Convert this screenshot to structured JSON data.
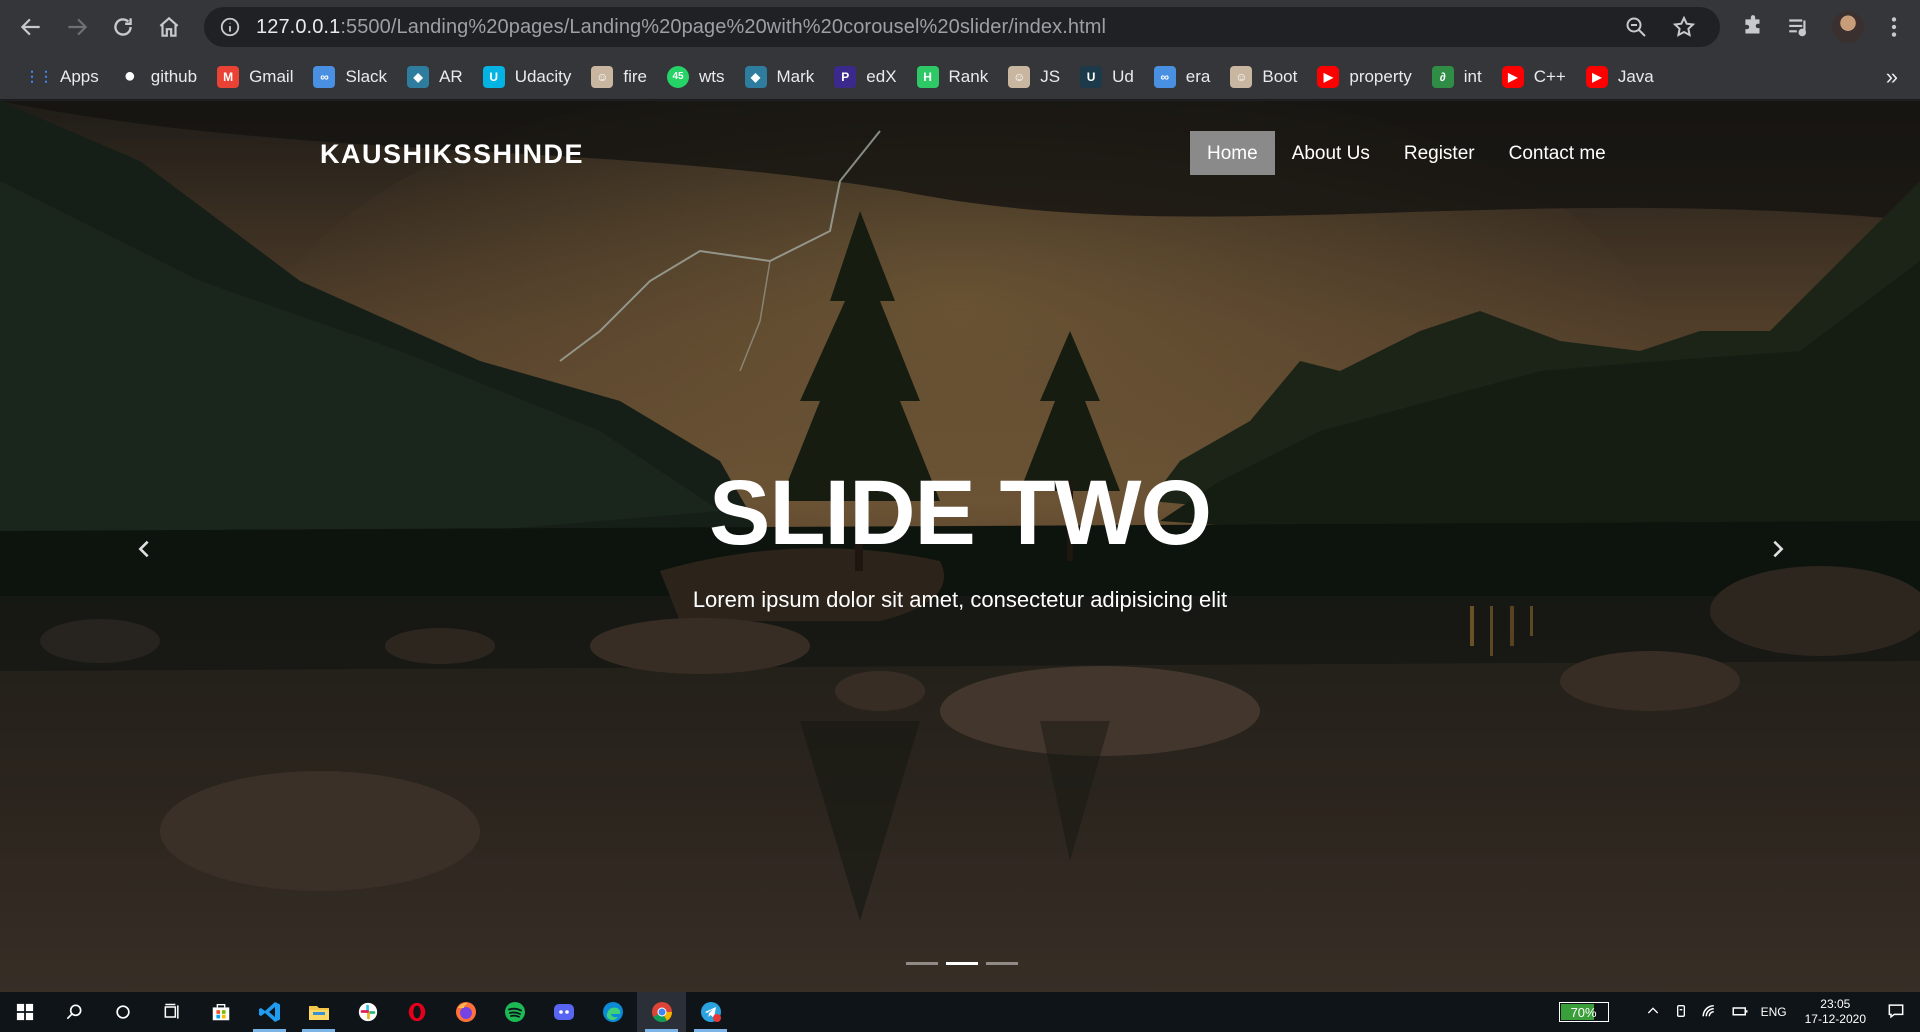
{
  "browser": {
    "url_host": "127.0.0.1",
    "url_path": ":5500/Landing%20pages/Landing%20page%20with%20corousel%20slider/index.html",
    "toolbar_icons": [
      "back-icon",
      "forward-icon",
      "reload-icon",
      "home-icon",
      "info-icon",
      "zoom-icon",
      "star-icon",
      "extensions-icon",
      "media-icon",
      "profile-avatar",
      "menu-icon"
    ]
  },
  "bookmarks": [
    {
      "label": "Apps",
      "icon": "apps-grid-icon",
      "color": "#4285f4"
    },
    {
      "label": "github",
      "icon": "github-icon",
      "color": "#ffffff"
    },
    {
      "label": "Gmail",
      "icon": "gmail-icon",
      "color": "#ea4335"
    },
    {
      "label": "Slack",
      "icon": "infinity-icon",
      "color": "#4a90e2"
    },
    {
      "label": "AR",
      "icon": "globe-icon",
      "color": "#2e7d9f"
    },
    {
      "label": "Udacity",
      "icon": "udacity-icon",
      "color": "#02b3e4"
    },
    {
      "label": "fire",
      "icon": "face-icon",
      "color": "#c9b6a0"
    },
    {
      "label": "wts",
      "icon": "whatsapp-icon",
      "color": "#25d366",
      "badge": "45"
    },
    {
      "label": "Mark",
      "icon": "globe-icon",
      "color": "#2e7d9f"
    },
    {
      "label": "edX",
      "icon": "p-icon",
      "color": "#3b2a8c"
    },
    {
      "label": "Rank",
      "icon": "hackerrank-icon",
      "color": "#2ec866"
    },
    {
      "label": "JS",
      "icon": "face-icon",
      "color": "#c9b6a0"
    },
    {
      "label": "Ud",
      "icon": "udemy-icon",
      "color": "#1c3a4a"
    },
    {
      "label": "era",
      "icon": "infinity-icon",
      "color": "#4a90e2"
    },
    {
      "label": "Boot",
      "icon": "face-icon",
      "color": "#c9b6a0"
    },
    {
      "label": "property",
      "icon": "youtube-icon",
      "color": "#ff0000"
    },
    {
      "label": "int",
      "icon": "gfg-icon",
      "color": "#2f8d46"
    },
    {
      "label": "C++",
      "icon": "youtube-icon",
      "color": "#ff0000"
    },
    {
      "label": "Java",
      "icon": "youtube-icon",
      "color": "#ff0000"
    }
  ],
  "bookmarks_overflow": "»",
  "page": {
    "brand": "KAUSHIKSSHINDE",
    "nav": [
      {
        "label": "Home",
        "active": true
      },
      {
        "label": "About Us",
        "active": false
      },
      {
        "label": "Register",
        "active": false
      },
      {
        "label": "Contact me",
        "active": false
      }
    ],
    "slide_title": "SLIDE TWO",
    "slide_caption": "Lorem ipsum dolor sit amet, consectetur adipisicing elit",
    "carousel": {
      "slides": 3,
      "active_index": 1
    },
    "prev_icon": "chevron-left-icon",
    "next_icon": "chevron-right-icon"
  },
  "taskbar": {
    "apps": [
      {
        "name": "start-icon"
      },
      {
        "name": "search-icon"
      },
      {
        "name": "cortana-icon"
      },
      {
        "name": "task-view-icon"
      },
      {
        "name": "store-icon"
      },
      {
        "name": "vscode-icon",
        "active": true
      },
      {
        "name": "file-explorer-icon",
        "active": true
      },
      {
        "name": "slack-icon"
      },
      {
        "name": "opera-icon"
      },
      {
        "name": "firefox-icon"
      },
      {
        "name": "spotify-icon"
      },
      {
        "name": "discord-icon"
      },
      {
        "name": "edge-icon"
      },
      {
        "name": "chrome-icon",
        "active": true,
        "running": true
      },
      {
        "name": "telegram-icon",
        "active": true
      }
    ],
    "battery": "70%",
    "battery_level": 0.7,
    "language": "ENG",
    "time": "23:05",
    "date": "17-12-2020"
  }
}
